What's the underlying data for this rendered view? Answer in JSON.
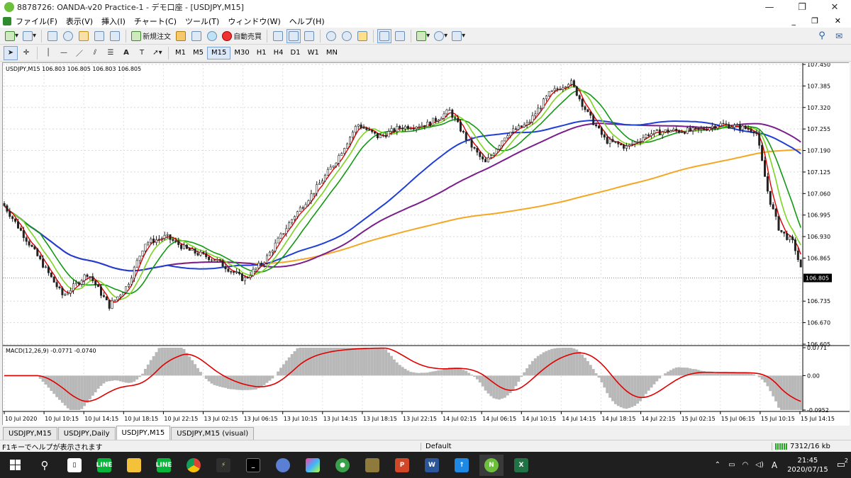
{
  "window": {
    "title": "8878726: OANDA-v20 Practice-1 - デモ口座 - [USDJPY,M15]",
    "min_glyph": "—",
    "max_glyph": "❐",
    "close_glyph": "✕"
  },
  "menu": {
    "items": [
      "ファイル(F)",
      "表示(V)",
      "挿入(I)",
      "チャート(C)",
      "ツール(T)",
      "ウィンドウ(W)",
      "ヘルプ(H)"
    ],
    "right_min": "_",
    "right_restore": "❐",
    "right_close": "✕"
  },
  "toolbar": {
    "new_order": "新規注文",
    "auto_trade": "自動売買"
  },
  "timeframes": [
    "M1",
    "M5",
    "M15",
    "M30",
    "H1",
    "H4",
    "D1",
    "W1",
    "MN"
  ],
  "active_timeframe": "M15",
  "chart_data": {
    "type": "line",
    "symbol_header": "USDJPY,M15  106.803 106.805 106.803 106.805",
    "current_price": "106.805",
    "price_ticks": [
      "107.450",
      "107.385",
      "107.320",
      "107.255",
      "107.190",
      "107.125",
      "107.060",
      "106.995",
      "106.930",
      "106.865",
      "106.805",
      "106.735",
      "106.670",
      "106.605"
    ],
    "ylim": [
      106.605,
      107.45
    ],
    "time_ticks": [
      "10 Jul 2020",
      "10 Jul 10:15",
      "10 Jul 14:15",
      "10 Jul 18:15",
      "10 Jul 22:15",
      "13 Jul 02:15",
      "13 Jul 06:15",
      "13 Jul 10:15",
      "13 Jul 14:15",
      "13 Jul 18:15",
      "13 Jul 22:15",
      "14 Jul 02:15",
      "14 Jul 06:15",
      "14 Jul 10:15",
      "14 Jul 14:15",
      "14 Jul 18:15",
      "14 Jul 22:15",
      "15 Jul 02:15",
      "15 Jul 06:15",
      "15 Jul 10:15",
      "15 Jul 14:15"
    ],
    "macd": {
      "label": "MACD(12,26,9) -0.0771 -0.0740",
      "ticks": [
        "0.0771",
        "0.00",
        "-0.0952"
      ],
      "ylim": [
        -0.0952,
        0.0771
      ]
    },
    "colors": {
      "price": "#222222",
      "ma_red": "#e00000",
      "ma_lime": "#7ed321",
      "ma_green": "#119911",
      "ma_blue": "#1f3fd8",
      "ma_purple": "#7a1e8c",
      "ma_orange": "#f5a623",
      "macd_hist": "#b8b8b8",
      "macd_signal": "#e00000"
    }
  },
  "tabs": [
    "USDJPY,M15",
    "USDJPY,Daily",
    "USDJPY,M15",
    "USDJPY,M15 (visual)"
  ],
  "active_tab": 2,
  "status": {
    "help": "F1キーでヘルプが表示されます",
    "profile": "Default",
    "traffic": "7312/16 kb"
  },
  "taskbar": {
    "time": "21:45",
    "date": "2020/07/15",
    "ime": "A",
    "notifications": "2"
  }
}
